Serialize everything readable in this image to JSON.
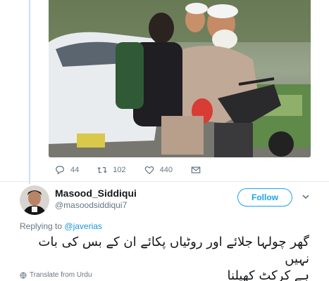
{
  "media": {
    "icon": "photo"
  },
  "actions": {
    "replies": "44",
    "retweets": "102",
    "likes": "440"
  },
  "reply_tweet": {
    "display_name": "Masood_Siddiqui",
    "handle": "@masoodsiddiqui7",
    "follow_label": "Follow",
    "replying_to_label": "Replying to",
    "replying_to_handle": "@javerias",
    "text_line1": "گھر چولہا جلائے اور روٹیاں پکائے ان کے بس کی بات نہیں",
    "text_line2": "ہے کرکٹ کھیلنا",
    "translate_label": "Translate from Urdu"
  },
  "colors": {
    "accent": "#1da1f2",
    "muted": "#657786",
    "thread_line": "#c9e0f3"
  }
}
